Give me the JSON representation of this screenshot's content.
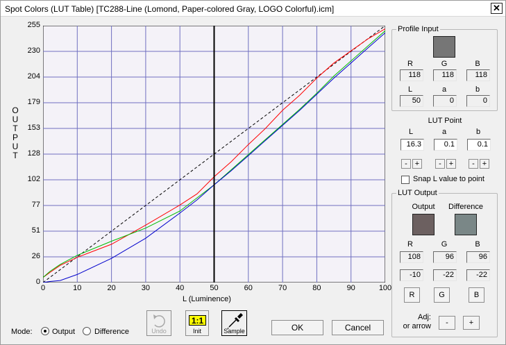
{
  "window": {
    "title": "Spot Colors (LUT Table) [TC288-Line (Lomond, Paper-colored Gray, LOGO Colorful).icm]",
    "close_glyph": "✕"
  },
  "chart": {
    "ylabel": "OUTPUT",
    "xlabel": "L (Luminence)",
    "y_ticks": [
      "255",
      "230",
      "204",
      "179",
      "153",
      "128",
      "102",
      "77",
      "51",
      "26",
      "0"
    ],
    "x_ticks": [
      "0",
      "10",
      "20",
      "30",
      "40",
      "50",
      "60",
      "70",
      "80",
      "90",
      "100"
    ]
  },
  "chart_data": {
    "type": "line",
    "xlabel": "L (Luminence)",
    "ylabel": "OUTPUT",
    "xlim": [
      0,
      100
    ],
    "ylim": [
      0,
      255
    ],
    "grid": true,
    "cursor_x": 50,
    "series": [
      {
        "color": "#000000",
        "dashed": true,
        "x": [
          0,
          100
        ],
        "y": [
          0,
          255
        ]
      },
      {
        "color": "#ff0000",
        "x": [
          0,
          2,
          5,
          10,
          20,
          30,
          40,
          45,
          50,
          55,
          60,
          65,
          70,
          75,
          80,
          85,
          90,
          95,
          100
        ],
        "y": [
          5,
          10,
          17,
          25,
          38,
          57,
          77,
          88,
          105,
          120,
          137,
          153,
          171,
          186,
          203,
          218,
          230,
          242,
          252
        ]
      },
      {
        "color": "#00bb00",
        "x": [
          0,
          2,
          5,
          10,
          20,
          30,
          40,
          45,
          50,
          55,
          60,
          65,
          70,
          75,
          80,
          85,
          90,
          95,
          100
        ],
        "y": [
          5,
          11,
          18,
          27,
          41,
          54,
          71,
          84,
          97,
          112,
          127,
          142,
          157,
          172,
          188,
          205,
          220,
          235,
          250
        ]
      },
      {
        "color": "#0000cc",
        "x": [
          0,
          2,
          5,
          10,
          20,
          30,
          40,
          45,
          50,
          55,
          60,
          65,
          70,
          75,
          80,
          85,
          90,
          95,
          100
        ],
        "y": [
          0,
          1,
          2,
          8,
          24,
          44,
          69,
          82,
          97,
          111,
          126,
          141,
          156,
          171,
          187,
          203,
          218,
          233,
          248
        ]
      }
    ]
  },
  "profile_input": {
    "title": "Profile Input",
    "swatch_color": "#767676",
    "r_label": "R",
    "g_label": "G",
    "b_label": "B",
    "r": "118",
    "g": "118",
    "b": "118",
    "l_label": "L",
    "a_label": "a",
    "bb_label": "b",
    "l": "50",
    "a": "0",
    "bb": "0"
  },
  "lut_point": {
    "title": "LUT Point",
    "l_label": "L",
    "a_label": "a",
    "b_label": "b",
    "l": "16.3",
    "a": "0.1",
    "b": "0.1",
    "minus": "-",
    "plus": "+",
    "snap_label": "Snap L value to point"
  },
  "lut_output": {
    "title": "LUT Output",
    "output_label": "Output",
    "difference_label": "Difference",
    "output_color": "#6c6060",
    "difference_color": "#7a8787",
    "r_label": "R",
    "g_label": "G",
    "b_label": "B",
    "r": "108",
    "g": "96",
    "b": "96",
    "dr": "-10",
    "dg": "-22",
    "db": "-22",
    "r_button": "R",
    "g_button": "G",
    "b_button": "B",
    "adj_label_1": "Adj:",
    "adj_label_2": "or arrow",
    "minus": "-",
    "plus": "+"
  },
  "toolbar": {
    "undo_label": "Undo",
    "init_label": "Init",
    "init_badge": "1:1",
    "sample_label": "Sample"
  },
  "mode": {
    "label": "Mode:",
    "output": "Output",
    "difference": "Difference",
    "selected": "Output"
  },
  "dialog": {
    "ok": "OK",
    "cancel": "Cancel"
  }
}
